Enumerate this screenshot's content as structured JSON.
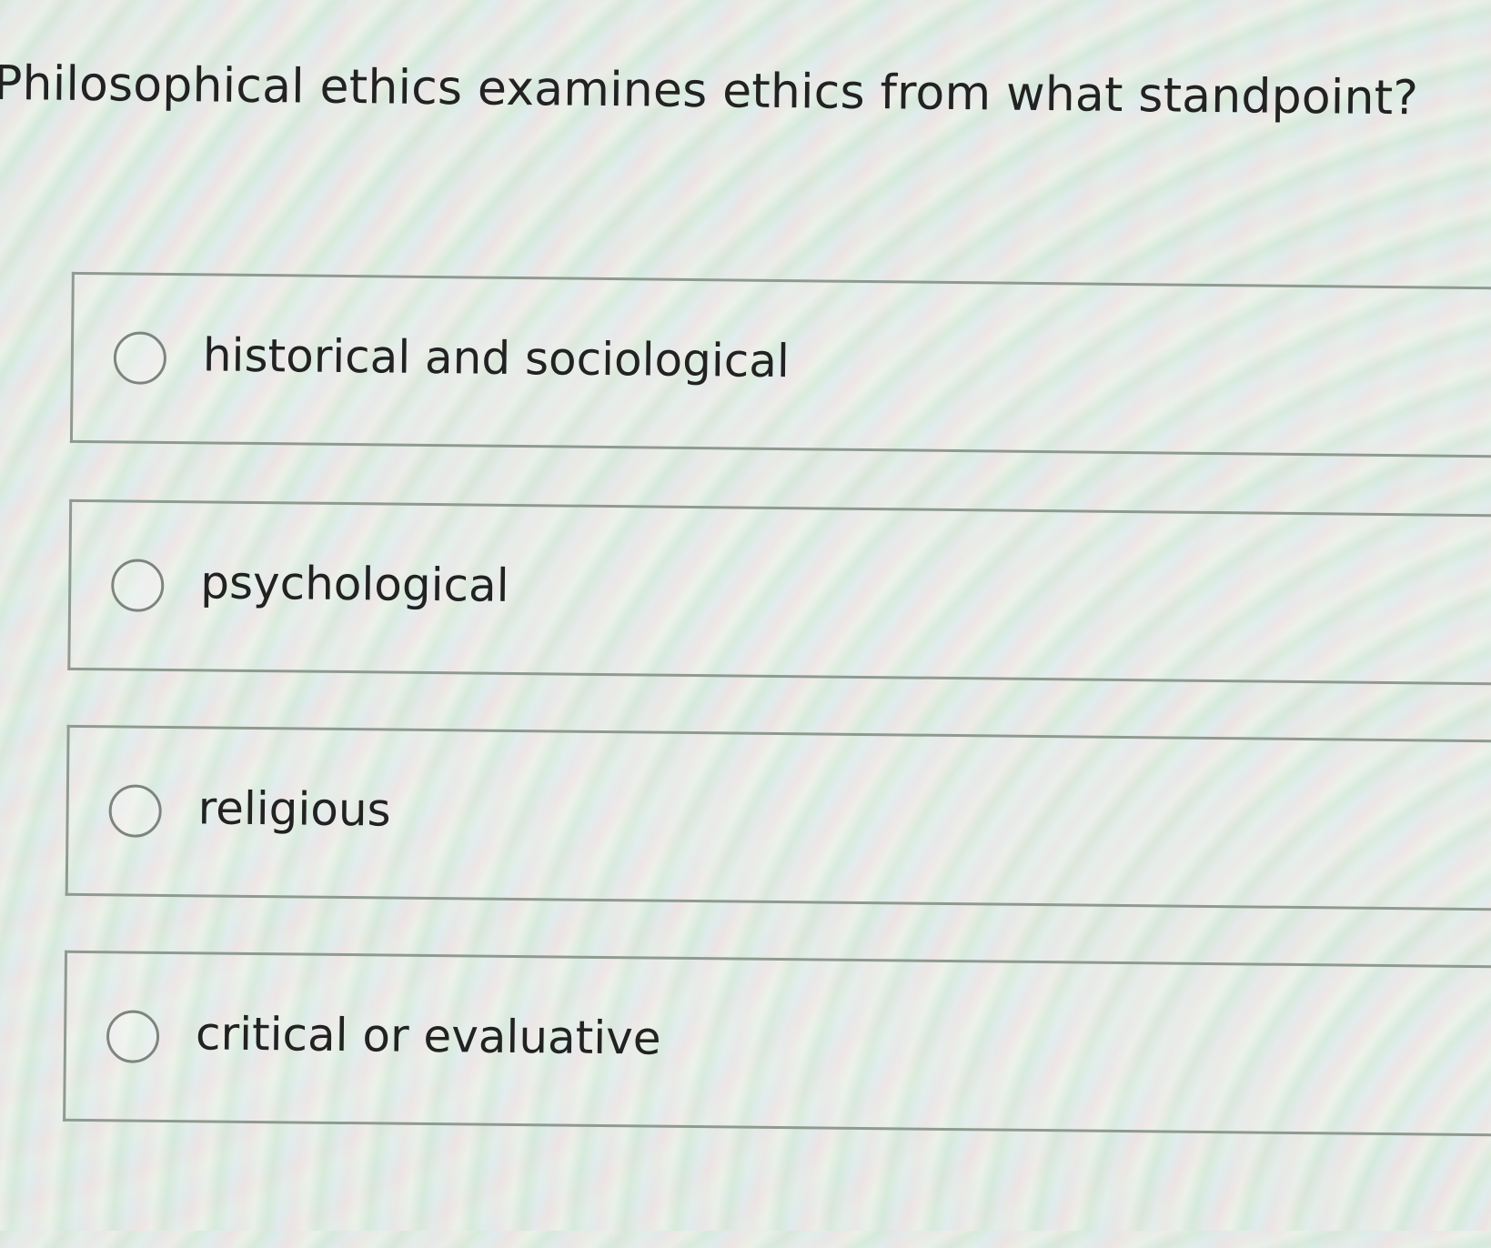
{
  "question": {
    "text": "Philosophical ethics examines ethics from what standpoint?"
  },
  "options": [
    {
      "label": "historical and sociological",
      "selected": false
    },
    {
      "label": "psychological",
      "selected": false
    },
    {
      "label": "religious",
      "selected": false
    },
    {
      "label": "critical or evaluative",
      "selected": false
    }
  ]
}
